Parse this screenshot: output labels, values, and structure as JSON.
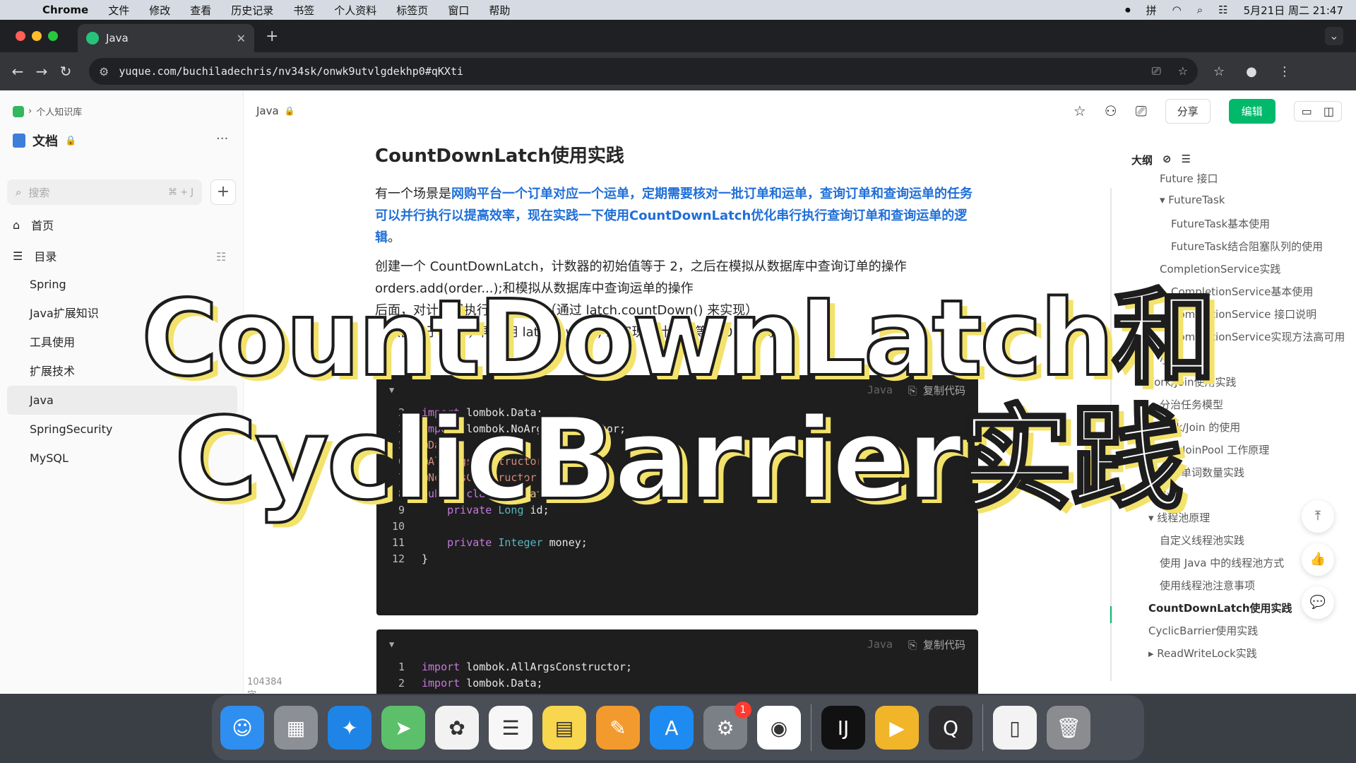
{
  "menubar": {
    "app": "Chrome",
    "items": [
      "文件",
      "修改",
      "查看",
      "历史记录",
      "书签",
      "个人资料",
      "标签页",
      "窗口",
      "帮助"
    ],
    "input_method": "拼",
    "datetime": "5月21日 周二 21:47"
  },
  "browser": {
    "tab_title": "Java",
    "url": "yuque.com/buchiladechris/nv34sk/onwk9utvlgdekhp0#qKXti"
  },
  "sidebar": {
    "breadcrumb": "个人知识库",
    "kb_title": "文档",
    "search_placeholder": "搜索",
    "search_shortcut": "⌘ + J",
    "nav": [
      {
        "label": "首页"
      },
      {
        "label": "目录"
      }
    ],
    "tree": [
      {
        "label": "Spring"
      },
      {
        "label": "Java扩展知识"
      },
      {
        "label": "工具使用"
      },
      {
        "label": "扩展技术"
      },
      {
        "label": "Java"
      },
      {
        "label": "SpringSecurity"
      },
      {
        "label": "MySQL"
      }
    ],
    "word_count": "104384 字"
  },
  "doc": {
    "breadcrumb_title": "Java",
    "share_label": "分享",
    "edit_label": "编辑",
    "title": "CountDownLatch使用实践",
    "para1_pre": "有一个场景是",
    "para1_highlight": "网购平台一个订单对应一个运单，定期需要核对一批订单和运单，查询订单和查询运单的任务可以并行执行以提高效率，现在实践一下使用CountDownLatch优化串行执行查询订单和查询运单的逻辑",
    "para1_post": "。",
    "para2_line1": "创建一个 CountDownLatch，计数器的初始值等于 2，之后在模拟从数据库中查询订单的操作",
    "para2_line2": "orders.add(order...);和模拟从数据库中查询运单的操作",
    "para2_line3": "后面，对计数器执行减 1 操作（通过 latch.countDown() 来实现）",
    "para2_line4": "计数器等于 0 时，再调用 latch.await() 来实现对计数器等于 0 的等待"
  },
  "code_blocks": [
    {
      "lang": "Java",
      "copy_label": "复制代码",
      "lines": [
        {
          "n": "2",
          "parts": [
            [
              "kw",
              "import"
            ],
            [
              "",
              " lombok.Data;"
            ]
          ]
        },
        {
          "n": "3",
          "parts": [
            [
              "kw",
              "import"
            ],
            [
              "",
              " lombok.NoArgsConstructor;"
            ]
          ]
        },
        {
          "n": "5",
          "parts": [
            [
              "at",
              "@"
            ],
            [
              "an",
              "Data"
            ]
          ]
        },
        {
          "n": "6",
          "parts": [
            [
              "at",
              "@"
            ],
            [
              "an",
              "AllArgsConstructor"
            ]
          ]
        },
        {
          "n": "7",
          "parts": [
            [
              "at",
              "@"
            ],
            [
              "an",
              "NoArgsConstructor"
            ]
          ]
        },
        {
          "n": "8",
          "parts": [
            [
              "kw",
              "public class "
            ],
            [
              "cl",
              "Dispatch"
            ],
            [
              "",
              " {"
            ]
          ]
        },
        {
          "n": "9",
          "parts": [
            [
              "",
              "    "
            ],
            [
              "kw",
              "private "
            ],
            [
              "ty",
              "Long"
            ],
            [
              "",
              " id;"
            ]
          ]
        },
        {
          "n": "10",
          "parts": [
            [
              "",
              ""
            ]
          ]
        },
        {
          "n": "11",
          "parts": [
            [
              "",
              "    "
            ],
            [
              "kw",
              "private "
            ],
            [
              "ty",
              "Integer"
            ],
            [
              "",
              " money;"
            ]
          ]
        },
        {
          "n": "12",
          "parts": [
            [
              "",
              "}"
            ]
          ]
        }
      ]
    },
    {
      "lang": "Java",
      "copy_label": "复制代码",
      "lines": [
        {
          "n": "1",
          "parts": [
            [
              "kw",
              "import"
            ],
            [
              "",
              " lombok.AllArgsConstructor;"
            ]
          ]
        },
        {
          "n": "2",
          "parts": [
            [
              "kw",
              "import"
            ],
            [
              "",
              " lombok.Data;"
            ]
          ]
        }
      ]
    }
  ],
  "outline": {
    "title": "大纲",
    "items": [
      {
        "label": "Future 接口",
        "level": 2
      },
      {
        "label": "FutureTask",
        "level": 2,
        "expanded": true
      },
      {
        "label": "FutureTask基本使用",
        "level": 3
      },
      {
        "label": "FutureTask结合阻塞队列的使用",
        "level": 3
      },
      {
        "label": "CompletionService实践",
        "level": 2
      },
      {
        "label": "CompletionService基本使用",
        "level": 3
      },
      {
        "label": "CompletionService 接口说明",
        "level": 3
      },
      {
        "label": "CompletionService实现方法高可用",
        "level": 3
      },
      {
        "label": "小结",
        "level": 2
      },
      {
        "label": "Fork/Join使用实践",
        "level": 1
      },
      {
        "label": "分治任务模型",
        "level": 2
      },
      {
        "label": "Fork/Join 的使用",
        "level": 2
      },
      {
        "label": "ForkJoinPool 工作原理",
        "level": 2
      },
      {
        "label": "统计单词数量实践",
        "level": 2
      },
      {
        "label": "小结",
        "level": 2
      },
      {
        "label": "线程池原理",
        "level": 1,
        "expanded": true
      },
      {
        "label": "自定义线程池实践",
        "level": 2
      },
      {
        "label": "使用 Java 中的线程池方式",
        "level": 2
      },
      {
        "label": "使用线程池注意事项",
        "level": 2
      },
      {
        "label": "CountDownLatch使用实践",
        "level": 1,
        "active": true
      },
      {
        "label": "CyclicBarrier使用实践",
        "level": 1
      },
      {
        "label": "ReadWriteLock实践",
        "level": 1,
        "collapsed": true
      }
    ]
  },
  "overlay": {
    "line1": "CountDownLatch和",
    "line2": "CyclicBarrier实践"
  },
  "dock": {
    "apps": [
      {
        "name": "finder-icon",
        "color": "#2e8ff0",
        "glyph": "☺"
      },
      {
        "name": "launchpad-icon",
        "color": "#8d8f96",
        "glyph": "▦"
      },
      {
        "name": "safari-icon",
        "color": "#1e84e6",
        "glyph": "✦"
      },
      {
        "name": "maps-icon",
        "color": "#5cc06a",
        "glyph": "➤"
      },
      {
        "name": "photos-icon",
        "color": "#f2f2f2",
        "glyph": "✿"
      },
      {
        "name": "reminders-icon",
        "color": "#f7f7f7",
        "glyph": "☰"
      },
      {
        "name": "notes-icon",
        "color": "#f8d64e",
        "glyph": "▤"
      },
      {
        "name": "pages-icon",
        "color": "#f29a2e",
        "glyph": "✎"
      },
      {
        "name": "app-store-icon",
        "color": "#1d8bf1",
        "glyph": "A"
      },
      {
        "name": "system-settings-icon",
        "color": "#7b7f86",
        "glyph": "⚙",
        "badge": "1"
      },
      {
        "name": "chrome-icon",
        "color": "#ffffff",
        "glyph": "◉"
      },
      {
        "name": "intellij-icon",
        "color": "#111111",
        "glyph": "IJ"
      },
      {
        "name": "infuse-icon",
        "color": "#f1b52a",
        "glyph": "▶"
      },
      {
        "name": "quicktime-icon",
        "color": "#2c2c2e",
        "glyph": "Q"
      },
      {
        "name": "documents-icon",
        "color": "#f3f3f3",
        "glyph": "▯"
      },
      {
        "name": "trash-icon",
        "color": "#8a8c90",
        "glyph": "🗑"
      }
    ]
  }
}
